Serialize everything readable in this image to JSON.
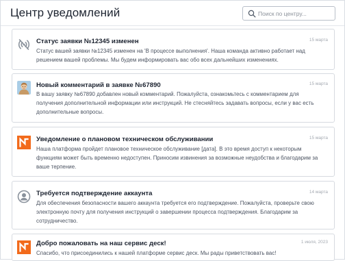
{
  "header": {
    "title": "Центр уведомлений",
    "search_placeholder": "Поиск по центру..."
  },
  "notifications": [
    {
      "icon": "signal-off-icon",
      "title": "Статус заявки №12345 изменен",
      "date": "15 марта",
      "text": "Статус вашей заявки №12345 изменен на 'В процессе выполнения'. Наша команда активно работает над решением вашей проблемы. Мы будем информировать вас обо всех дальнейших изменениях."
    },
    {
      "icon": "user-avatar-icon",
      "title": "Новый комментарий в заявке №67890",
      "date": "15 марта",
      "text": "В вашу заявку №67890 добавлен новый комментарий. Пожалуйста, ознакомьтесь с комментарием для получения дополнительной информации или инструкций. Не стесняйтесь задавать вопросы, если у вас есть дополнительные вопросы."
    },
    {
      "icon": "brand-logo-icon",
      "title": "Уведомление о плановом техническом обслуживании",
      "date": "15 марта",
      "text": "Наша платформа пройдет плановое техническое обслуживание [дата]. В это время доступ к некоторым функциям может быть временно недоступен. Приносим извинения за возможные неудобства и благодарим за ваше терпение."
    },
    {
      "icon": "account-circle-icon",
      "title": "Требуется подтверждение аккаунта",
      "date": "14 марта",
      "text": "Для обеспечения безопасности вашего аккаунта требуется его подтверждение. Пожалуйста, проверьте свою электронную почту для получения инструкций о завершении процесса подтверждения. Благодарим за сотрудничество."
    },
    {
      "icon": "brand-logo-icon",
      "title": "Добро пожаловать на наш сервис деск!",
      "date": "1 июля, 2023",
      "text": "Спасибо, что присоединились к нашей платформе сервис деск. Мы рады приветствовать вас!"
    }
  ],
  "colors": {
    "brand_orange": "#f26a1b",
    "border": "#d6dae0",
    "title_text": "#1c2330",
    "body_text": "#4a5260",
    "date_text": "#a4a9b1"
  }
}
